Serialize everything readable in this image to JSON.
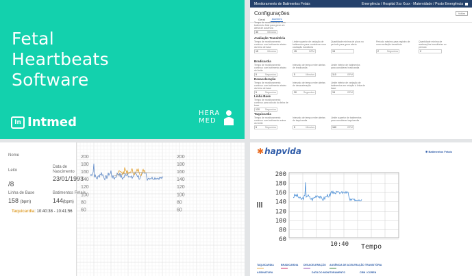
{
  "brand_panel": {
    "title_lines": [
      "Fetal",
      "Heartbeats",
      "Software"
    ],
    "logo_mark": "In",
    "logo_text": "Intmed",
    "partner_line1": "HERA",
    "partner_line2": "MED",
    "bg_color": "#13d1ad"
  },
  "config_panel": {
    "topbar_title": "Monitoramento de Batimentos Fetais",
    "topbar_right": "Emergência / Hospital Xxx Xxxx · Maternidade / Posto Emergência",
    "page_title": "Configurações",
    "back_label": "Voltar",
    "tabs": [
      "Geral",
      "Alarmes"
    ],
    "active_tab": "Alarmes",
    "sections": [
      {
        "title": "",
        "fields": [
          {
            "desc": "Tempo de monitoramento sem batimento fetal para gerar um alerta de ausência",
            "value": "30",
            "unit": "Minutos"
          }
        ]
      },
      {
        "title": "Avaliação Transitória",
        "fields": [
          {
            "desc": "Tempo de monitoramento contínuo com batimento abaixo da linha de base",
            "value": "15",
            "unit": "Minutos"
          },
          {
            "desc": "Limite superior de variação de batimentos para considerar uma oscilação transitória",
            "value": "15",
            "unit": "BPM"
          },
          {
            "desc": "Quantidade mínima de picos no período para gerar alerta",
            "value": "15",
            "unit": ""
          },
          {
            "desc": "Período máximo para registro de uma oscilação transitória",
            "value": "2",
            "unit": "Segundos"
          },
          {
            "desc": "Quantidade mínima de acelerações transitórias no período",
            "value": "2",
            "unit": ""
          }
        ]
      },
      {
        "title": "Bradicardia",
        "fields": [
          {
            "desc": "Tempo de monitoramento contínuo com batimento abaixo do limite",
            "value": "5",
            "unit": "Segundos"
          },
          {
            "desc": "Intervalo de tempo entre alertas de bradicardia",
            "value": "5",
            "unit": "Minutos"
          },
          {
            "desc": "Limite inferior de batimentos para considerar bradicardia",
            "value": "110",
            "unit": "BPM"
          }
        ]
      },
      {
        "title": "Desaceleração",
        "fields": [
          {
            "desc": "Tempo de monitoramento contínuo com batimento abaixo da linha de base",
            "value": "5",
            "unit": "Segundos"
          },
          {
            "desc": "Intervalo de tempo entre alertas de desaceleração",
            "value": "30",
            "unit": "Segundos"
          },
          {
            "desc": "Limite inferior de variação de batimentos em relação à linha de base",
            "value": "15",
            "unit": "BPM"
          }
        ]
      },
      {
        "title": "Linha Base",
        "fields": [
          {
            "desc": "Tempo de monitoramento contínuo para cálculo da linha de base",
            "value": "120",
            "unit": "Segundos"
          }
        ]
      },
      {
        "title": "Taquicardia",
        "fields": [
          {
            "desc": "Tempo de monitoramento contínuo com batimento acima do limite",
            "value": "5",
            "unit": "Segundos"
          },
          {
            "desc": "Intervalo de tempo entre alertas de taquicardia",
            "value": "5",
            "unit": "Minutos"
          },
          {
            "desc": "Limite superior de batimentos para considerar taquicardia",
            "value": "160",
            "unit": "BPM"
          }
        ]
      }
    ]
  },
  "monitor_panel": {
    "name_label": "Nome",
    "bed_label": "Leito",
    "bed_value": "/8",
    "birth_label_1": "Data de",
    "birth_label_2": "Nascimento",
    "birth_value": "23/01/1993",
    "baseline_label": "Linha de Base",
    "baseline_value": "158",
    "baseline_unit": "(bpm)",
    "fetal_label": "Batimentos Fetais",
    "fetal_value": "144",
    "fetal_unit": "(bpm)",
    "event_label": "Taquicardia",
    "event_range": "10:40:38 - 10:41:56",
    "axis_ticks": [
      "200",
      "180",
      "160",
      "140",
      "120",
      "100",
      "80",
      "60"
    ],
    "colors": {
      "main": "#5b86c4",
      "highlight": "#e3a53c",
      "baseline": "#b0a48e"
    }
  },
  "report_panel": {
    "brand": "hapvida",
    "header_right": "Batimentos Fetais",
    "y_ticks": [
      "200",
      "180",
      "160",
      "140",
      "120",
      "100",
      "80",
      "60"
    ],
    "x_tick": "10:40",
    "x_label": "Tempo",
    "legend": [
      {
        "label": "TAQUICARDIA",
        "color": "#e3a53c"
      },
      {
        "label": "BRADICARDIA",
        "color": "#c2185b"
      },
      {
        "label": "DESACELERAÇÃO",
        "color": "#8e44ad"
      },
      {
        "label": "AUSÊNCIA DE ACELERAÇÃO TRANSITÓRIA",
        "color": "#2e7d32"
      }
    ],
    "legend_row2": [
      "ASSINATURA",
      "DATA DO MONITORAMENTO",
      "CRM / COREN"
    ]
  }
}
